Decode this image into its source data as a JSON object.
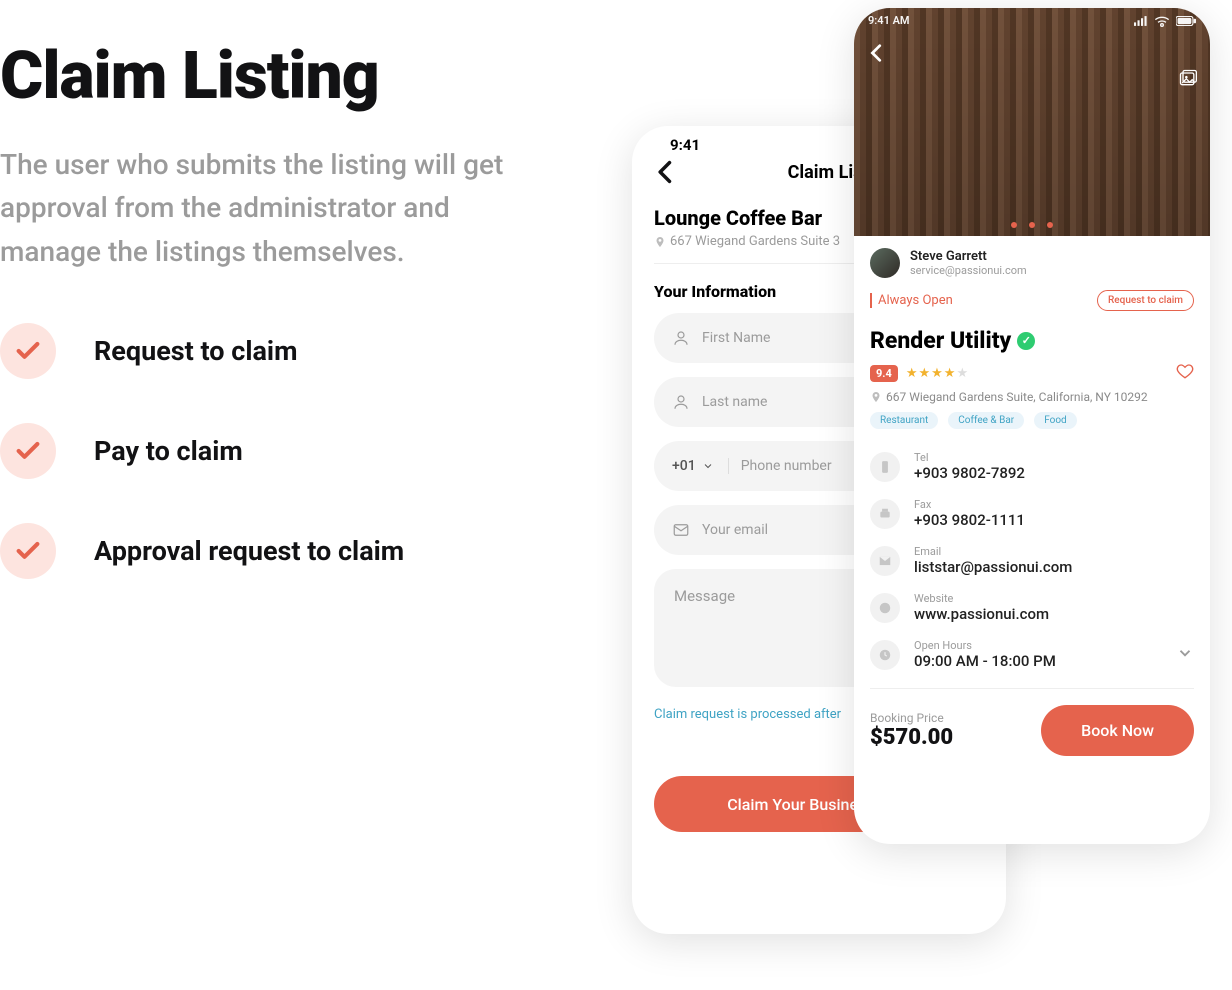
{
  "left": {
    "title": "Claim Listing",
    "description": "The user who submits the listing will get approval from the administrator and manage the listings themselves.",
    "bullets": [
      "Request to claim",
      "Pay to claim",
      "Approval request to claim"
    ]
  },
  "back_phone": {
    "status_time": "9:41",
    "header_title": "Claim List",
    "business_name": "Lounge Coffee Bar",
    "business_address": "667 Wiegand Gardens Suite 3",
    "section_title": "Your Information",
    "placeholders": {
      "first_name": "First Name",
      "last_name": "Last name",
      "phone_prefix": "+01",
      "phone": "Phone number",
      "email": "Your email",
      "message": "Message"
    },
    "note": "Claim request is processed after",
    "cta": "Claim Your Business Now"
  },
  "front_phone": {
    "status_time": "9:41 AM",
    "owner_name": "Steve Garrett",
    "owner_email": "service@passionui.com",
    "open_status": "Always Open",
    "request_btn": "Request to claim",
    "title": "Render Utility",
    "rating": "9.4",
    "address": "667 Wiegand Gardens Suite, California, NY 10292",
    "tags": [
      "Restaurant",
      "Coffee & Bar",
      "Food"
    ],
    "info": {
      "tel_label": "Tel",
      "tel_value": "+903 9802-7892",
      "fax_label": "Fax",
      "fax_value": "+903 9802-1111",
      "email_label": "Email",
      "email_value": "liststar@passionui.com",
      "website_label": "Website",
      "website_value": "www.passionui.com",
      "hours_label": "Open Hours",
      "hours_value": "09:00 AM - 18:00 PM"
    },
    "price_label": "Booking Price",
    "price_value": "$570.00",
    "book_btn": "Book Now"
  }
}
